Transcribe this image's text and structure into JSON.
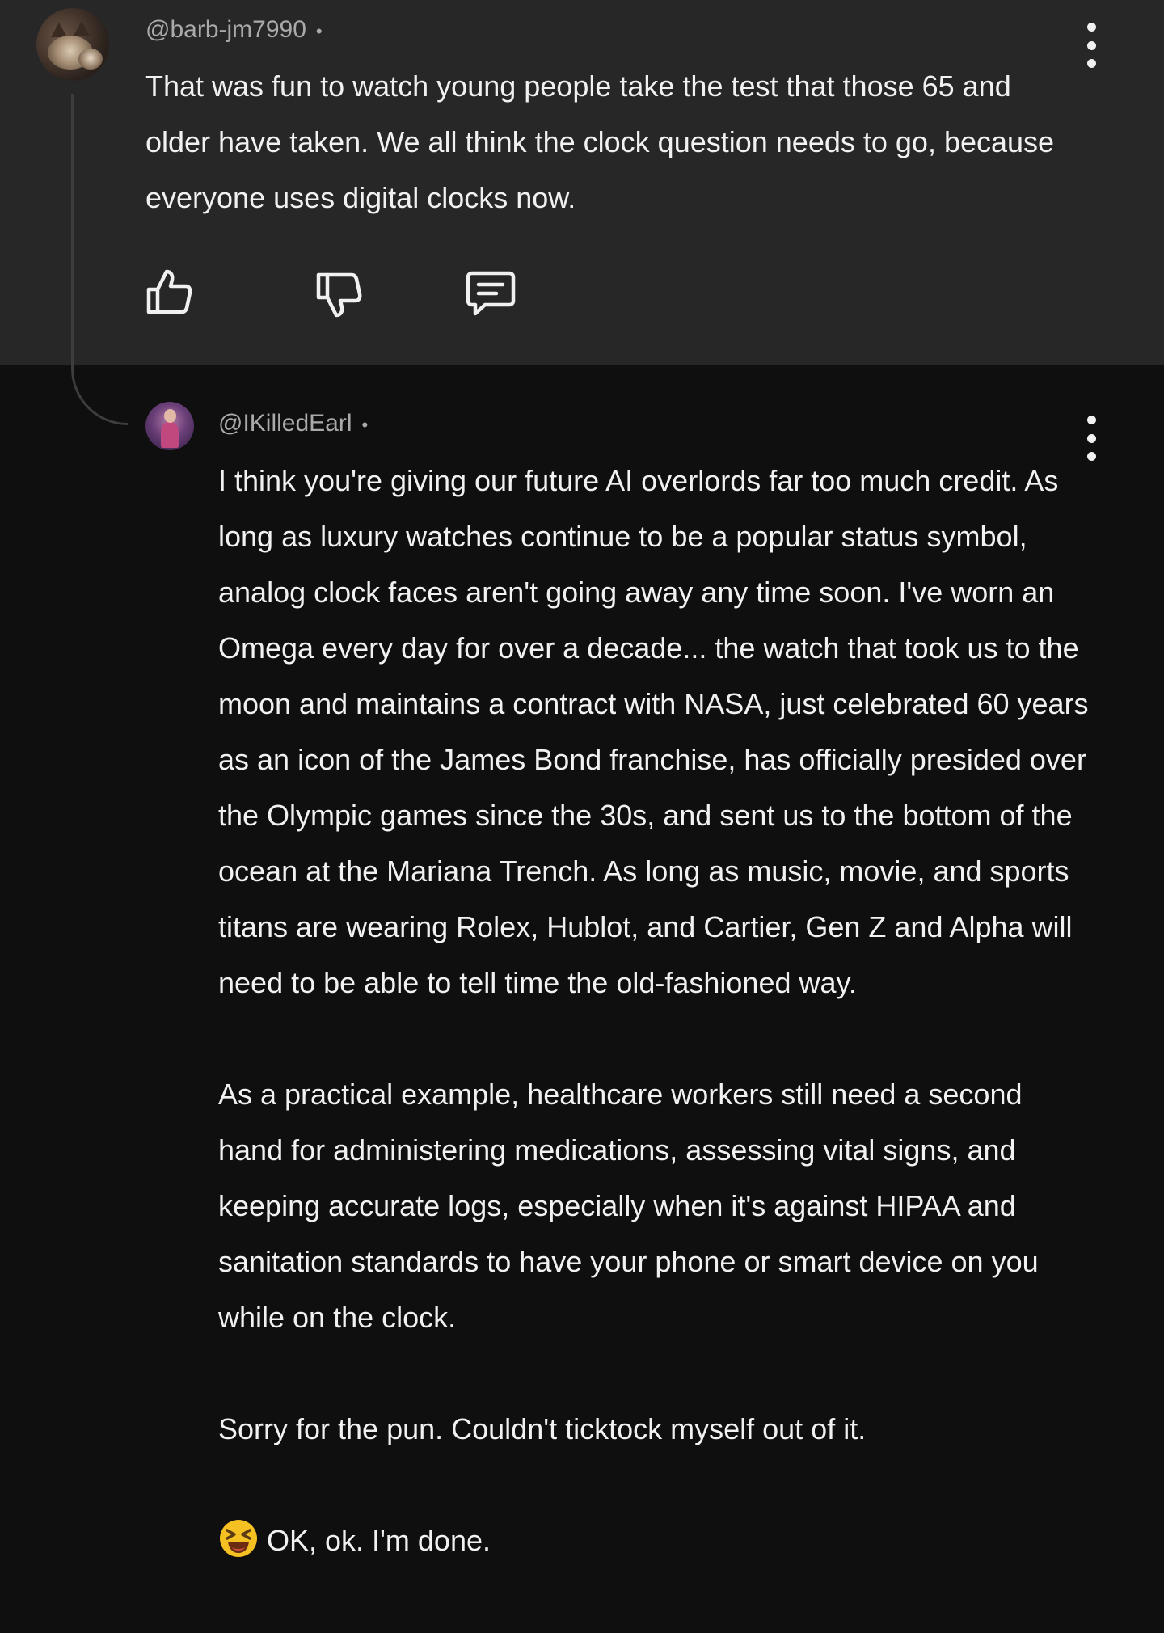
{
  "comments": [
    {
      "handle": "@barb-jm7990",
      "separator": "•",
      "text": "That was fun to watch young people take the test that those 65 and older have taken.  We all think the clock question needs to go, because everyone uses digital clocks now.",
      "avatar_icon": "cat-avatar"
    },
    {
      "handle": "@IKilledEarl",
      "separator": "•",
      "avatar_icon": "person-avatar",
      "paragraphs": [
        "I think you're giving our future AI overlords far too much credit. As long as luxury watches continue to be a popular status symbol, analog clock faces aren't going away any time soon. I've worn an Omega every day for over a decade... the watch that took us to the moon and maintains a contract with NASA, just celebrated 60 years as an icon of the James Bond franchise, has officially presided over the Olympic games since the 30s, and sent us to the bottom of the ocean at the Mariana Trench. As long as music, movie, and sports titans are wearing Rolex, Hublot, and Cartier, Gen Z and Alpha will need to be able to tell time the old-fashioned way.",
        "As a practical example, healthcare workers still need a second hand for administering medications, assessing vital signs, and keeping accurate logs, especially when it's against HIPAA and sanitation standards to have your phone or smart device on you while on the clock.",
        "Sorry for the pun. Couldn't ticktock myself out of it."
      ],
      "last_line": "OK, ok. I'm done.",
      "last_line_emoji": "laughing-squint-emoji"
    }
  ],
  "actions": {
    "like_icon": "thumbs-up-icon",
    "dislike_icon": "thumbs-down-icon",
    "reply_icon": "reply-comment-icon"
  },
  "colors": {
    "page_background": "#0f0f0f",
    "top_comment_background": "#272727",
    "text": "#f1f1f1",
    "secondary_text": "#aaaaaa"
  }
}
